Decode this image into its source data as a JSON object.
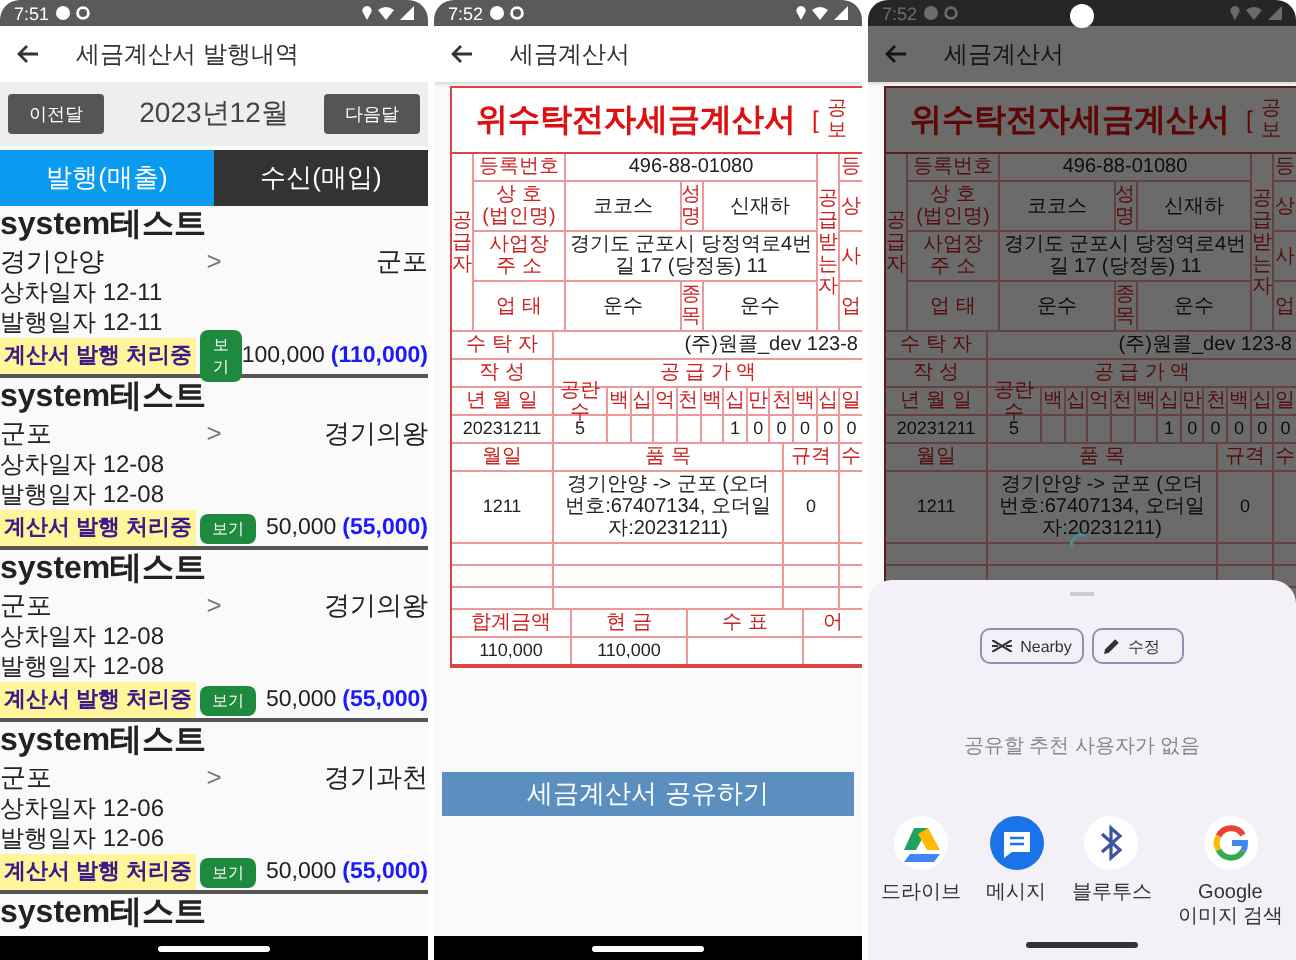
{
  "list_screen": {
    "status_time": "7:51",
    "title": "세금계산서 발행내역",
    "prev_button": "이전달",
    "month": "2023년12월",
    "next_button": "다음달",
    "tabs": [
      {
        "label": "발행(매출)",
        "selected": true
      },
      {
        "label": "수신(매입)",
        "selected": false
      }
    ],
    "items": [
      {
        "company": "system테스트",
        "from": "경기안양",
        "arrow": ">",
        "to": "군포",
        "loading_date": "상차일자 12-11",
        "issue_date": "발행일자 12-11",
        "status": "계산서 발행 처리중",
        "view_button": "보기",
        "amount": "100,000",
        "total": "(110,000)"
      },
      {
        "company": "system테스트",
        "from": "군포",
        "arrow": ">",
        "to": "경기의왕",
        "loading_date": "상차일자 12-08",
        "issue_date": "발행일자 12-08",
        "status": "계산서 발행 처리중",
        "view_button": "보기",
        "amount": "50,000",
        "total": "(55,000)"
      },
      {
        "company": "system테스트",
        "from": "군포",
        "arrow": ">",
        "to": "경기의왕",
        "loading_date": "상차일자 12-08",
        "issue_date": "발행일자 12-08",
        "status": "계산서 발행 처리중",
        "view_button": "보기",
        "amount": "50,000",
        "total": "(55,000)"
      },
      {
        "company": "system테스트",
        "from": "군포",
        "arrow": ">",
        "to": "경기과천",
        "loading_date": "상차일자 12-06",
        "issue_date": "발행일자 12-06",
        "status": "계산서 발행 처리중",
        "view_button": "보기",
        "amount": "50,000",
        "total": "(55,000)"
      }
    ],
    "partial_item": {
      "company": "system테스트"
    }
  },
  "invoice_screen": {
    "status_time": "7:52",
    "title": "세금계산서",
    "invoice": {
      "title": "위수탁전자세금계산서",
      "bracket": "[",
      "copy_mark": "공보",
      "supplier_heading": "공급자",
      "buyer_heading": "공급받는자",
      "reg_label": "등록번호",
      "reg_no": "496-88-01080",
      "name_label": "상 호\n(법인명)",
      "name": "코코스",
      "rep_label": "성명",
      "rep": "신재하",
      "addr_label": "사업장\n주 소",
      "address": "경기도 군포시 당정역로4번길 17 (당정동) 11",
      "biz_label": "업 태",
      "biz_type": "운수",
      "item_label": "종목",
      "biz_item": "운수",
      "buyer_labels": [
        "등",
        "상",
        "사",
        "업"
      ],
      "trustee_label": "수 탁 자",
      "trustee": "(주)원콜_dev 123-8",
      "written_label": "작 성",
      "supply_label": "공 급 가 액",
      "date_label": "년 월 일",
      "blank_label": "공란수",
      "digit_labels": [
        "백",
        "십",
        "억",
        "천",
        "백",
        "십",
        "만",
        "천",
        "백",
        "십",
        "일"
      ],
      "date": "20231211",
      "blank_count": "5",
      "digits": [
        "1",
        "0",
        "0",
        "0",
        "0",
        "0"
      ],
      "line_header": {
        "date": "월일",
        "item": "품 목",
        "spec": "규격",
        "qty": "수"
      },
      "lines": [
        {
          "date": "1211",
          "item": "경기안양 -> 군포 (오더번호:67407134, 오더일자:20231211)",
          "spec": "0"
        }
      ],
      "totals": {
        "labels": [
          "합계금액",
          "현 금",
          "수 표",
          "어"
        ],
        "values": [
          "110,000",
          "110,000"
        ]
      }
    },
    "share_button": "세금계산서 공유하기"
  },
  "share_screen": {
    "status_time": "7:52",
    "title": "세금계산서",
    "invoice": {
      "title": "위수탁전자세금계산서",
      "bracket": "[",
      "copy_mark": "공보",
      "supplier_heading": "공급자",
      "buyer_heading": "공급받는자",
      "reg_label": "등록번호",
      "reg_no": "496-88-01080",
      "name_label": "상 호\n(법인명)",
      "name": "코코스",
      "rep_label": "성명",
      "rep": "신재하",
      "addr_label": "사업장\n주 소",
      "address": "경기도 군포시 당정역로4번길 17 (당정동) 11",
      "biz_label": "업 태",
      "biz_type": "운수",
      "item_label": "종목",
      "biz_item": "운수",
      "buyer_labels": [
        "등",
        "상",
        "사",
        "업"
      ],
      "trustee_label": "수 탁 자",
      "trustee": "(주)원콜_dev 123-8",
      "written_label": "작 성",
      "supply_label": "공 급 가 액",
      "date_label": "년 월 일",
      "blank_label": "공란수",
      "digit_labels": [
        "백",
        "십",
        "억",
        "천",
        "백",
        "십",
        "만",
        "천",
        "백",
        "십",
        "일"
      ],
      "date": "20231211",
      "blank_count": "5",
      "digits": [
        "1",
        "0",
        "0",
        "0",
        "0",
        "0"
      ],
      "line_header": {
        "date": "월일",
        "item": "품 목",
        "spec": "규격",
        "qty": "수"
      },
      "lines": [
        {
          "date": "1211",
          "item": "경기안양 -> 군포 (오더번호:67407134, 오더일자:20231211)",
          "spec": "0"
        }
      ]
    },
    "sheet": {
      "chips": [
        {
          "label": "Nearby",
          "kind": "nearby"
        },
        {
          "label": "수정",
          "kind": "edit"
        }
      ],
      "empty_message": "공유할 추천 사용자가 없음",
      "apps": [
        {
          "label": "드라이브",
          "kind": "drive"
        },
        {
          "label": "메시지",
          "kind": "messages"
        },
        {
          "label": "블루투스",
          "kind": "bluetooth"
        },
        {
          "label": "Google\n이미지 검색",
          "kind": "google"
        }
      ]
    }
  }
}
